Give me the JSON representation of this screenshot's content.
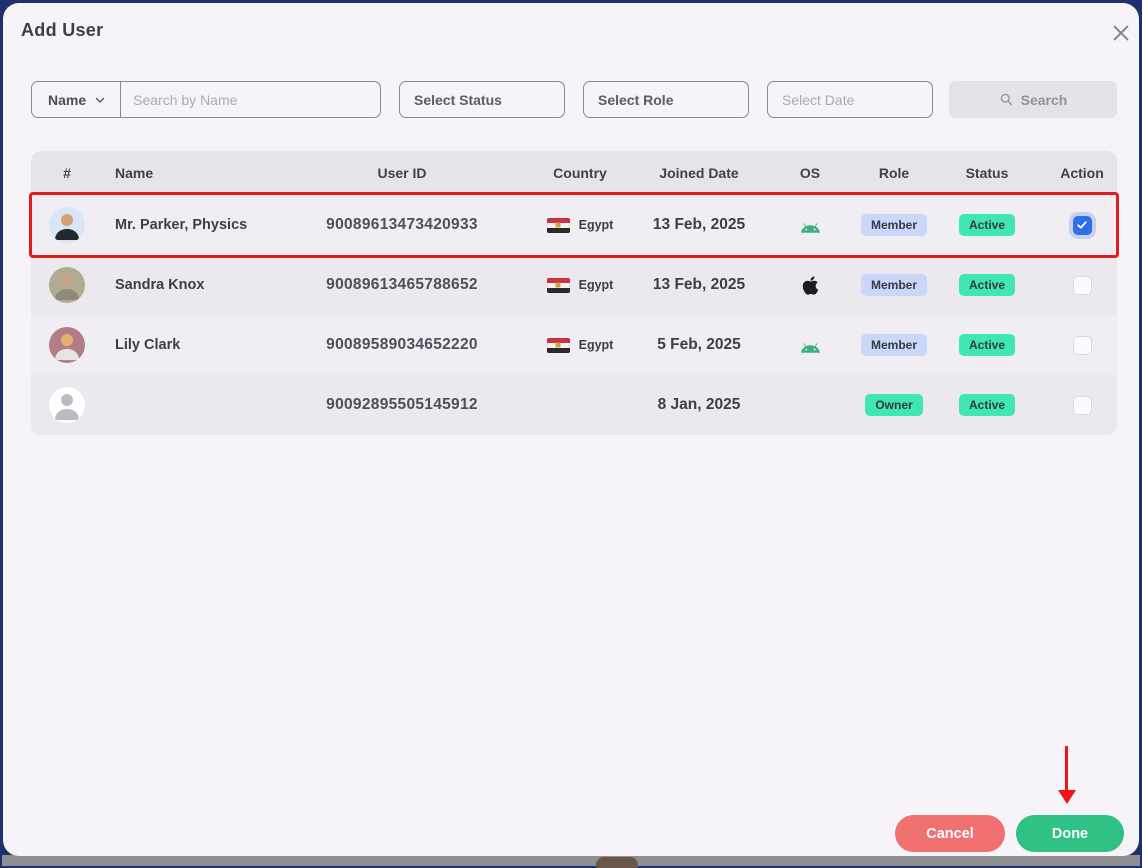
{
  "modal": {
    "title": "Add User",
    "close_icon": "close-x"
  },
  "filters": {
    "name_dropdown": {
      "label": "Name"
    },
    "search_input": {
      "placeholder": "Search by Name",
      "value": ""
    },
    "status_select": {
      "value": "Select Status"
    },
    "role_select": {
      "value": "Select Role"
    },
    "date_select": {
      "placeholder": "Select Date"
    },
    "search_button": {
      "label": "Search",
      "icon": "magnifier-icon"
    }
  },
  "table": {
    "columns": [
      "#",
      "Name",
      "User ID",
      "Country",
      "Joined Date",
      "OS",
      "Role",
      "Status",
      "Action"
    ],
    "rows": [
      {
        "name": "Mr. Parker, Physics",
        "user_id": "90089613473420933",
        "country": "Egypt",
        "joined_date": "13 Feb, 2025",
        "os": "android",
        "role": "Member",
        "status": "Active",
        "checked": true,
        "highlighted": true,
        "avatar": "photo-man-suit"
      },
      {
        "name": "Sandra Knox",
        "user_id": "90089613465788652",
        "country": "Egypt",
        "joined_date": "13 Feb, 2025",
        "os": "apple",
        "role": "Member",
        "status": "Active",
        "checked": false,
        "highlighted": false,
        "avatar": "photo-woman-olive"
      },
      {
        "name": "Lily Clark",
        "user_id": "90089589034652220",
        "country": "Egypt",
        "joined_date": "5 Feb, 2025",
        "os": "android",
        "role": "Member",
        "status": "Active",
        "checked": false,
        "highlighted": false,
        "avatar": "photo-woman-rose"
      },
      {
        "name": "",
        "user_id": "90092895505145912",
        "country": "",
        "joined_date": "8 Jan, 2025",
        "os": "",
        "role": "Owner",
        "status": "Active",
        "checked": false,
        "highlighted": false,
        "avatar": "placeholder-person"
      }
    ]
  },
  "footer": {
    "cancel_label": "Cancel",
    "done_label": "Done"
  },
  "annotations": {
    "selected_row": "Mr. Parker, Physics",
    "arrow_points_to": "Done"
  },
  "colors": {
    "accent_blue_checkbox": "#2f6ee8",
    "highlight_red": "#e01c1c",
    "arrow_red": "#ee1418",
    "cancel_button": "#f0716f",
    "done_button": "#30c185",
    "badge_member_bg": "#cad7f8",
    "badge_active_bg": "#41e7b1",
    "badge_owner_bg": "#41e7b1",
    "android_green": "#3fb27f",
    "apple_black": "#1d1d1f",
    "frame_navy": "#20306b"
  }
}
